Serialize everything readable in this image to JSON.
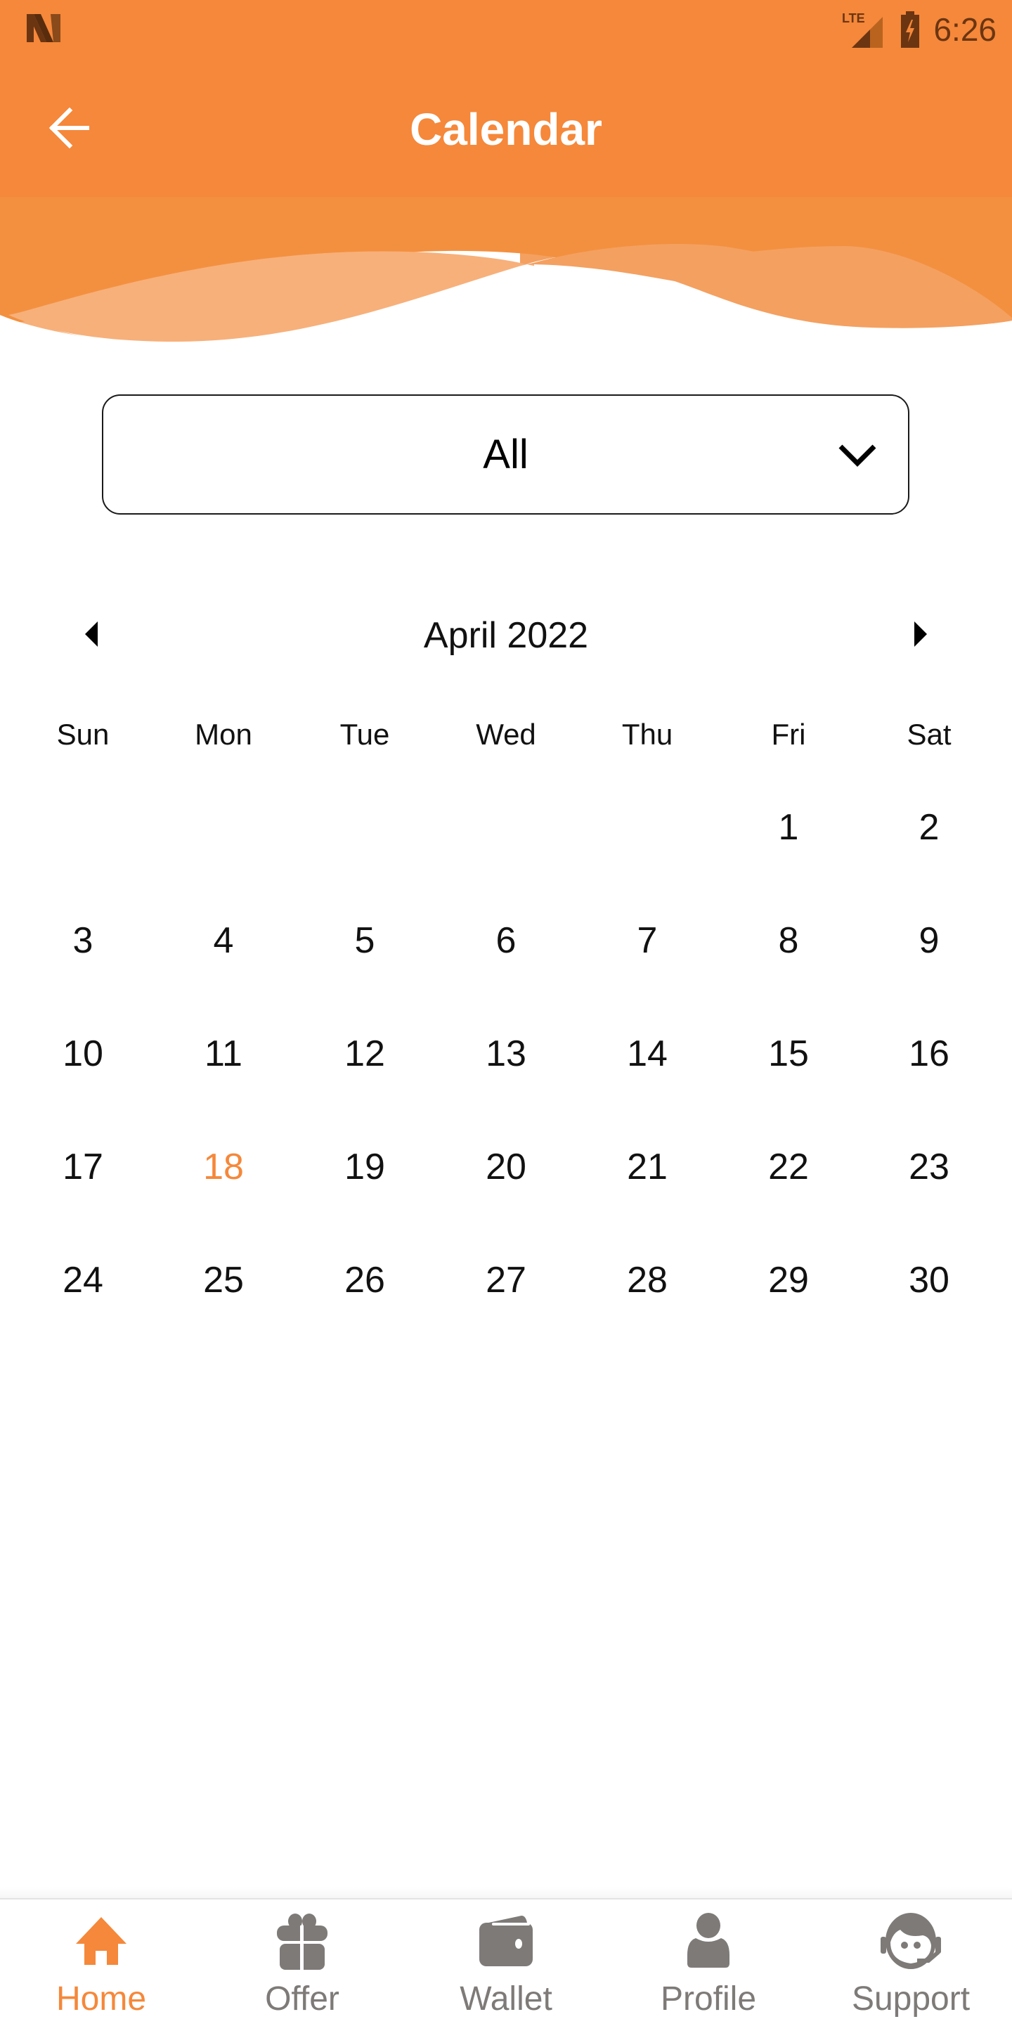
{
  "status_bar": {
    "time": "6:26",
    "network": "LTE",
    "icons": [
      "notification-n-icon",
      "lte-signal-icon",
      "battery-charging-icon"
    ]
  },
  "header": {
    "title": "Calendar",
    "back_icon": "arrow-left-icon"
  },
  "colors": {
    "accent": "#F5883A",
    "wave_light": "#F7B07A",
    "wave_mid": "#F4A060",
    "nav_inactive": "#7D7A78"
  },
  "filter": {
    "selected": "All",
    "icon": "chevron-down-icon"
  },
  "calendar": {
    "month_label": "April 2022",
    "prev_icon": "triangle-left-icon",
    "next_icon": "triangle-right-icon",
    "weekdays": [
      "Sun",
      "Mon",
      "Tue",
      "Wed",
      "Thu",
      "Fri",
      "Sat"
    ],
    "weeks": [
      [
        "",
        "",
        "",
        "",
        "",
        "1",
        "2"
      ],
      [
        "3",
        "4",
        "5",
        "6",
        "7",
        "8",
        "9"
      ],
      [
        "10",
        "11",
        "12",
        "13",
        "14",
        "15",
        "16"
      ],
      [
        "17",
        "18",
        "19",
        "20",
        "21",
        "22",
        "23"
      ],
      [
        "24",
        "25",
        "26",
        "27",
        "28",
        "29",
        "30"
      ]
    ],
    "today": "18"
  },
  "bottom_nav": {
    "items": [
      {
        "label": "Home",
        "icon": "home-icon",
        "active": true
      },
      {
        "label": "Offer",
        "icon": "gift-icon",
        "active": false
      },
      {
        "label": "Wallet",
        "icon": "wallet-icon",
        "active": false
      },
      {
        "label": "Profile",
        "icon": "person-icon",
        "active": false
      },
      {
        "label": "Support",
        "icon": "support-agent-icon",
        "active": false
      }
    ]
  }
}
